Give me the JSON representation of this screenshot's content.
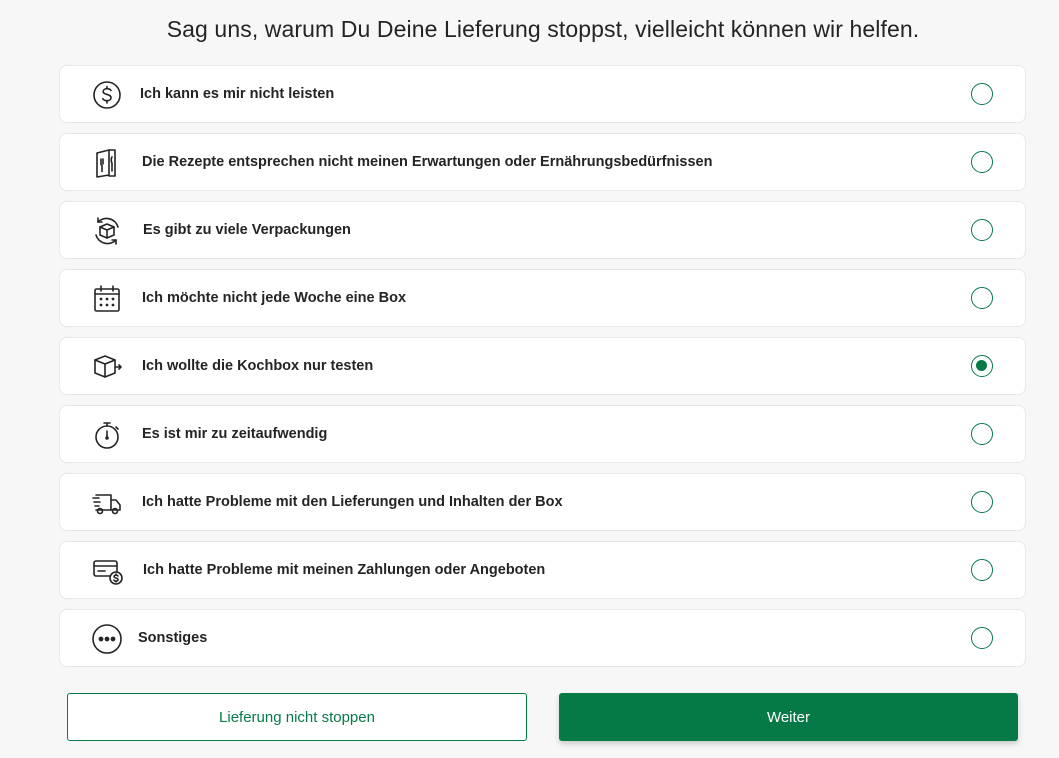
{
  "header": {
    "title": "Sag uns, warum Du Deine Lieferung stoppst, vielleicht können wir helfen."
  },
  "options": [
    {
      "label": "Ich kann es mir nicht leisten",
      "icon": "dollar-coin-icon",
      "selected": false
    },
    {
      "label": "Die Rezepte entsprechen nicht meinen Erwartungen oder Ernährungsbedürfnissen",
      "icon": "recipe-card-icon",
      "selected": false
    },
    {
      "label": "Es gibt zu viele Verpackungen",
      "icon": "packaging-recycle-icon",
      "selected": false
    },
    {
      "label": "Ich möchte nicht jede Woche eine Box",
      "icon": "calendar-icon",
      "selected": false
    },
    {
      "label": "Ich wollte die Kochbox nur testen",
      "icon": "box-out-icon",
      "selected": true
    },
    {
      "label": "Es ist mir zu zeitaufwendig",
      "icon": "stopwatch-icon",
      "selected": false
    },
    {
      "label": "Ich hatte Probleme mit den Lieferungen und Inhalten der Box",
      "icon": "delivery-truck-icon",
      "selected": false
    },
    {
      "label": "Ich hatte Probleme mit meinen Zahlungen oder Angeboten",
      "icon": "credit-card-dollar-icon",
      "selected": false
    },
    {
      "label": "Sonstiges",
      "icon": "more-dots-icon",
      "selected": false
    }
  ],
  "actions": {
    "cancel_label": "Lieferung nicht stoppen",
    "continue_label": "Weiter"
  },
  "colors": {
    "accent": "#067a46",
    "background": "#f7f7f7",
    "text": "#242424"
  }
}
